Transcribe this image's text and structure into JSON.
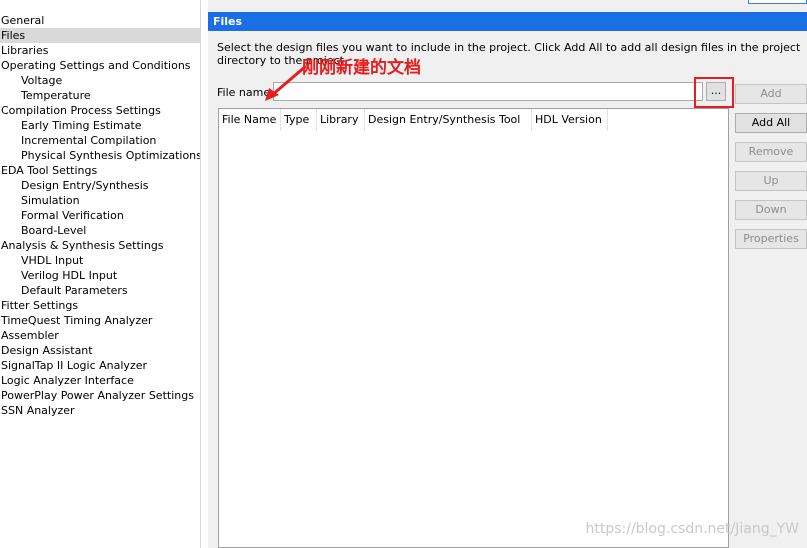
{
  "tree": {
    "items": [
      {
        "label": "General",
        "level": 0,
        "selected": false
      },
      {
        "label": "Files",
        "level": 0,
        "selected": true
      },
      {
        "label": "Libraries",
        "level": 0,
        "selected": false
      },
      {
        "label": "Operating Settings and Conditions",
        "level": 0,
        "selected": false
      },
      {
        "label": "Voltage",
        "level": 1,
        "selected": false
      },
      {
        "label": "Temperature",
        "level": 1,
        "selected": false
      },
      {
        "label": "Compilation Process Settings",
        "level": 0,
        "selected": false
      },
      {
        "label": "Early Timing Estimate",
        "level": 1,
        "selected": false
      },
      {
        "label": "Incremental Compilation",
        "level": 1,
        "selected": false
      },
      {
        "label": "Physical Synthesis Optimizations",
        "level": 1,
        "selected": false
      },
      {
        "label": "EDA Tool Settings",
        "level": 0,
        "selected": false
      },
      {
        "label": "Design Entry/Synthesis",
        "level": 1,
        "selected": false
      },
      {
        "label": "Simulation",
        "level": 1,
        "selected": false
      },
      {
        "label": "Formal Verification",
        "level": 1,
        "selected": false
      },
      {
        "label": "Board-Level",
        "level": 1,
        "selected": false
      },
      {
        "label": "Analysis & Synthesis Settings",
        "level": 0,
        "selected": false
      },
      {
        "label": "VHDL Input",
        "level": 1,
        "selected": false
      },
      {
        "label": "Verilog HDL Input",
        "level": 1,
        "selected": false
      },
      {
        "label": "Default Parameters",
        "level": 1,
        "selected": false
      },
      {
        "label": "Fitter Settings",
        "level": 0,
        "selected": false
      },
      {
        "label": "TimeQuest Timing Analyzer",
        "level": 0,
        "selected": false
      },
      {
        "label": "Assembler",
        "level": 0,
        "selected": false
      },
      {
        "label": "Design Assistant",
        "level": 0,
        "selected": false
      },
      {
        "label": "SignalTap II Logic Analyzer",
        "level": 0,
        "selected": false
      },
      {
        "label": "Logic Analyzer Interface",
        "level": 0,
        "selected": false
      },
      {
        "label": "PowerPlay Power Analyzer Settings",
        "level": 0,
        "selected": false
      },
      {
        "label": "SSN Analyzer",
        "level": 0,
        "selected": false
      }
    ]
  },
  "panel": {
    "title": "Files",
    "description": "Select the design files you want to include in the project. Click Add All to add all design files in the project directory to the project.",
    "file_name_label": "File name:",
    "file_name_value": "",
    "browse_label": "...",
    "columns": [
      "File Name",
      "Type",
      "Library",
      "Design Entry/Synthesis Tool",
      "HDL Version"
    ],
    "buttons": {
      "add": "Add",
      "add_all": "Add All",
      "remove": "Remove",
      "up": "Up",
      "down": "Down",
      "properties": "Properties"
    }
  },
  "annotation": {
    "text": "刚刚新建的文档",
    "color": "#e81e1e"
  },
  "watermark": "https://blog.csdn.net/Jiang_YW",
  "colors": {
    "header_bg": "#1a6ee6",
    "selected_bg": "#d9d9d9",
    "annotation": "#e81e1e"
  }
}
